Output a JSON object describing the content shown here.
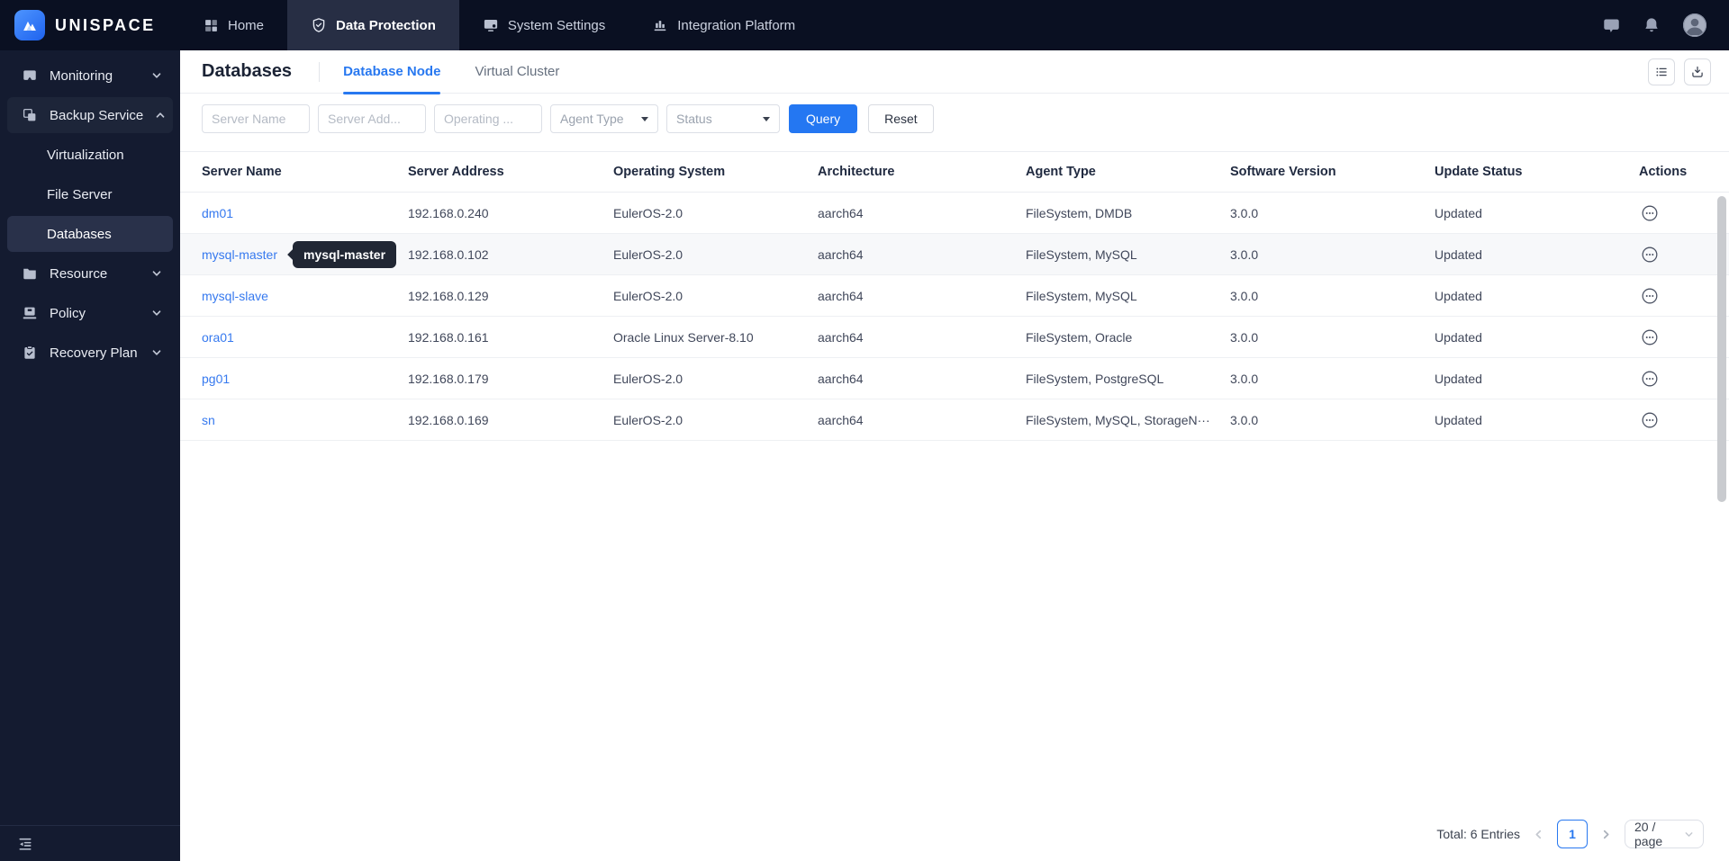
{
  "colors": {
    "accent": "#2878f0",
    "link": "#3679ef",
    "topbar_bg": "#0a1022",
    "sidebar_bg": "#141b30"
  },
  "topbar": {
    "logo_text": "UNISPACE",
    "nav": [
      {
        "label": "Home",
        "icon": "grid-icon",
        "active": false
      },
      {
        "label": "Data Protection",
        "icon": "shield-icon",
        "active": true
      },
      {
        "label": "System Settings",
        "icon": "monitor-icon",
        "active": false
      },
      {
        "label": "Integration Platform",
        "icon": "bar-chart-icon",
        "active": false
      }
    ]
  },
  "sidebar": {
    "items": [
      {
        "label": "Monitoring",
        "icon": "monitoring-icon",
        "chevron": "down"
      },
      {
        "label": "Backup Service",
        "icon": "backup-copy-icon",
        "chevron": "up",
        "expanded": true
      },
      {
        "label": "Virtualization",
        "child": true
      },
      {
        "label": "File Server",
        "child": true
      },
      {
        "label": "Databases",
        "child": true,
        "active": true
      },
      {
        "label": "Resource",
        "icon": "folder-icon",
        "chevron": "down"
      },
      {
        "label": "Policy",
        "icon": "policy-device-icon",
        "chevron": "down"
      },
      {
        "label": "Recovery Plan",
        "icon": "clipboard-check-icon",
        "chevron": "down"
      }
    ]
  },
  "content": {
    "page_title": "Databases",
    "tabs": [
      {
        "label": "Database Node",
        "active": true
      },
      {
        "label": "Virtual Cluster",
        "active": false
      }
    ],
    "filters": {
      "server_name_placeholder": "Server Name",
      "server_address_placeholder": "Server Add...",
      "operating_system_placeholder": "Operating ...",
      "agent_type_label": "Agent Type",
      "status_label": "Status",
      "query_label": "Query",
      "reset_label": "Reset"
    },
    "table": {
      "columns": [
        "Server Name",
        "Server Address",
        "Operating System",
        "Architecture",
        "Agent Type",
        "Software Version",
        "Update Status",
        "Actions"
      ],
      "rows": [
        {
          "server_name": "dm01",
          "server_address": "192.168.0.240",
          "operating_system": "EulerOS-2.0",
          "architecture": "aarch64",
          "agent_type": "FileSystem, DMDB",
          "software_version": "3.0.0",
          "update_status": "Updated"
        },
        {
          "server_name": "mysql-master",
          "server_address": "192.168.0.102",
          "operating_system": "EulerOS-2.0",
          "architecture": "aarch64",
          "agent_type": "FileSystem, MySQL",
          "software_version": "3.0.0",
          "update_status": "Updated",
          "highlighted": true,
          "tooltip": "mysql-master"
        },
        {
          "server_name": "mysql-slave",
          "server_address": "192.168.0.129",
          "operating_system": "EulerOS-2.0",
          "architecture": "aarch64",
          "agent_type": "FileSystem, MySQL",
          "software_version": "3.0.0",
          "update_status": "Updated"
        },
        {
          "server_name": "ora01",
          "server_address": "192.168.0.161",
          "operating_system": "Oracle Linux Server-8.10",
          "architecture": "aarch64",
          "agent_type": "FileSystem, Oracle",
          "software_version": "3.0.0",
          "update_status": "Updated"
        },
        {
          "server_name": "pg01",
          "server_address": "192.168.0.179",
          "operating_system": "EulerOS-2.0",
          "architecture": "aarch64",
          "agent_type": "FileSystem, PostgreSQL",
          "software_version": "3.0.0",
          "update_status": "Updated"
        },
        {
          "server_name": "sn",
          "server_address": "192.168.0.169",
          "operating_system": "EulerOS-2.0",
          "architecture": "aarch64",
          "agent_type": "FileSystem, MySQL, StorageN···",
          "software_version": "3.0.0",
          "update_status": "Updated"
        }
      ]
    },
    "pagination": {
      "total_text": "Total: 6 Entries",
      "current_page": "1",
      "page_size_label": "20 / page"
    }
  }
}
